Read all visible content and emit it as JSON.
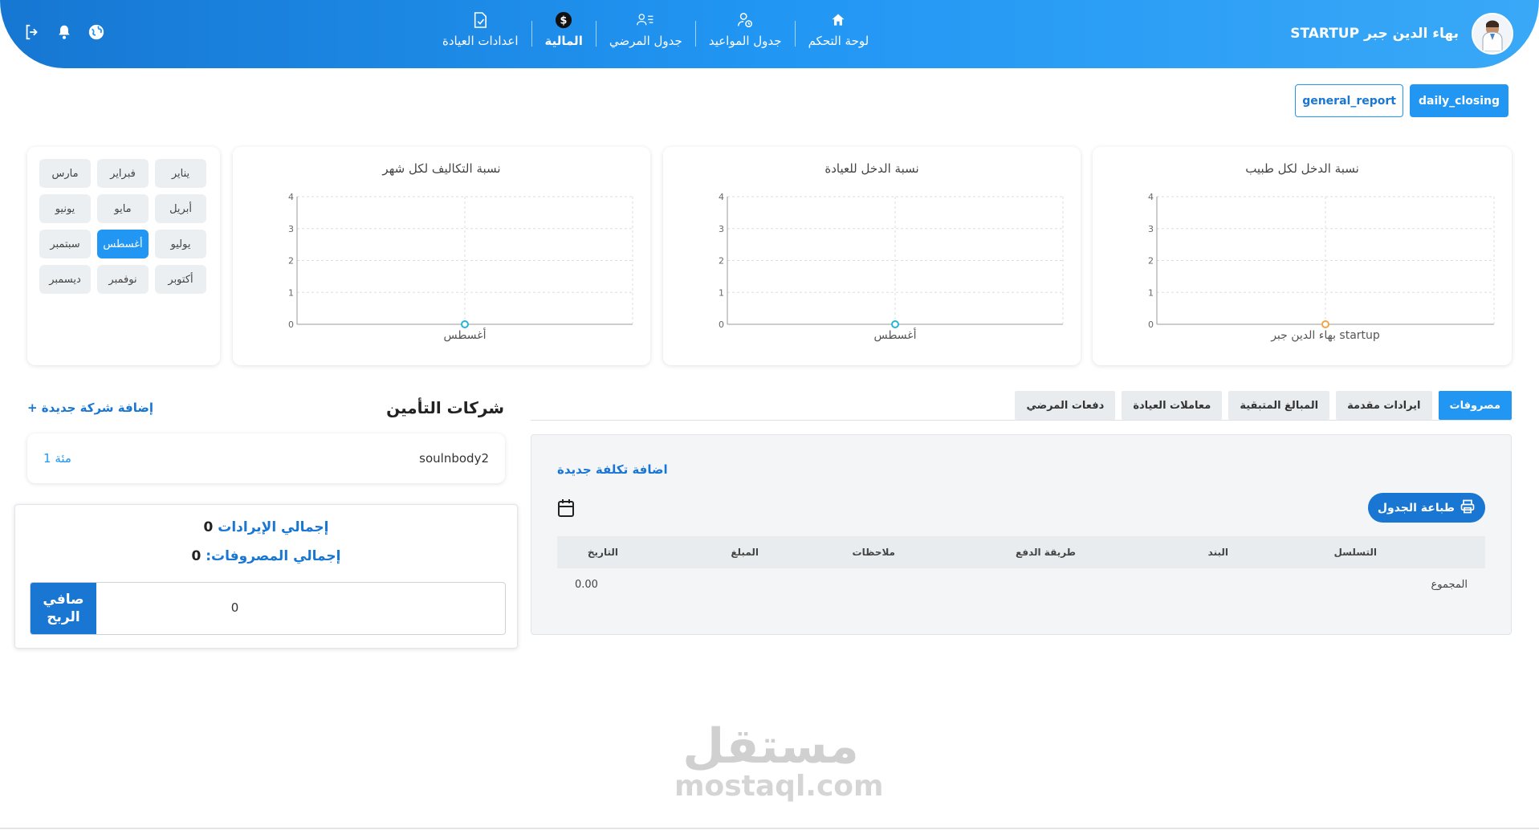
{
  "header": {
    "user_name": "بهاء الدين جبر STARTUP",
    "nav": [
      {
        "label": "لوحة التحكم",
        "icon": "home-icon"
      },
      {
        "label": "جدول المواعيد",
        "icon": "appointments-icon"
      },
      {
        "label": "جدول المرضي",
        "icon": "patients-list-icon"
      },
      {
        "label": "المالية",
        "icon": "dollar-icon"
      },
      {
        "label": "اعدادات العيادة",
        "icon": "document-check-icon"
      }
    ],
    "active_nav": "المالية"
  },
  "reports": {
    "daily_closing": "daily_closing",
    "general_report": "general_report"
  },
  "charts": [
    {
      "title": "نسبة الدخل لكل طبيب",
      "chart_data": {
        "type": "line",
        "categories": [
          "بهاء الدين جبر startup"
        ],
        "values": [
          0
        ],
        "ylim": [
          0,
          4
        ],
        "yticks": [
          "0",
          "1",
          "2",
          "3",
          "4"
        ],
        "color": "#f5a34a"
      }
    },
    {
      "title": "نسبة الدخل للعيادة",
      "chart_data": {
        "type": "line",
        "categories": [
          "أغسطس"
        ],
        "values": [
          0
        ],
        "ylim": [
          0,
          4
        ],
        "yticks": [
          "0",
          "1",
          "2",
          "3",
          "4"
        ],
        "color": "#26b6d4"
      }
    },
    {
      "title": "نسبة التكاليف لكل شهر",
      "chart_data": {
        "type": "line",
        "categories": [
          "أغسطس"
        ],
        "values": [
          0
        ],
        "ylim": [
          0,
          4
        ],
        "yticks": [
          "0",
          "1",
          "2",
          "3",
          "4"
        ],
        "color": "#26b6d4"
      }
    }
  ],
  "months": [
    "يناير",
    "فبراير",
    "مارس",
    "أبريل",
    "مايو",
    "يونيو",
    "يوليو",
    "أغسطس",
    "سبتمبر",
    "أكتوبر",
    "نوفمبر",
    "ديسمبر"
  ],
  "active_month": "أغسطس",
  "tabs": [
    "مصروفات",
    "ايرادات مقدمة",
    "المبالغ المتبقية",
    "معاملات العيادة",
    "دفعات المرضي"
  ],
  "active_tab": "مصروفات",
  "expenses": {
    "add_label": "اضافة تكلفة جديدة",
    "print_label": "طباعة الجدول",
    "columns": [
      "التسلسل",
      "البند",
      "طريقة الدفع",
      "ملاحظات",
      "المبلغ",
      "التاريخ"
    ],
    "total_label": "المجموع",
    "total_value": "0.00"
  },
  "insurance": {
    "title": "شركات التأمين",
    "add_label": "+ إضافة شركة جديدة",
    "companies": [
      {
        "name": "soulnbody2",
        "pct": "1 مئة"
      }
    ]
  },
  "summary": {
    "revenue_label": "إجمالي الإيرادات",
    "revenue_value": "0",
    "expense_label": "إجمالي المصروفات:",
    "expense_value": "0",
    "net_value": "0",
    "net_label": "صافي الربح"
  },
  "watermark": {
    "ar": "مستقل",
    "en": "mostaql.com"
  }
}
